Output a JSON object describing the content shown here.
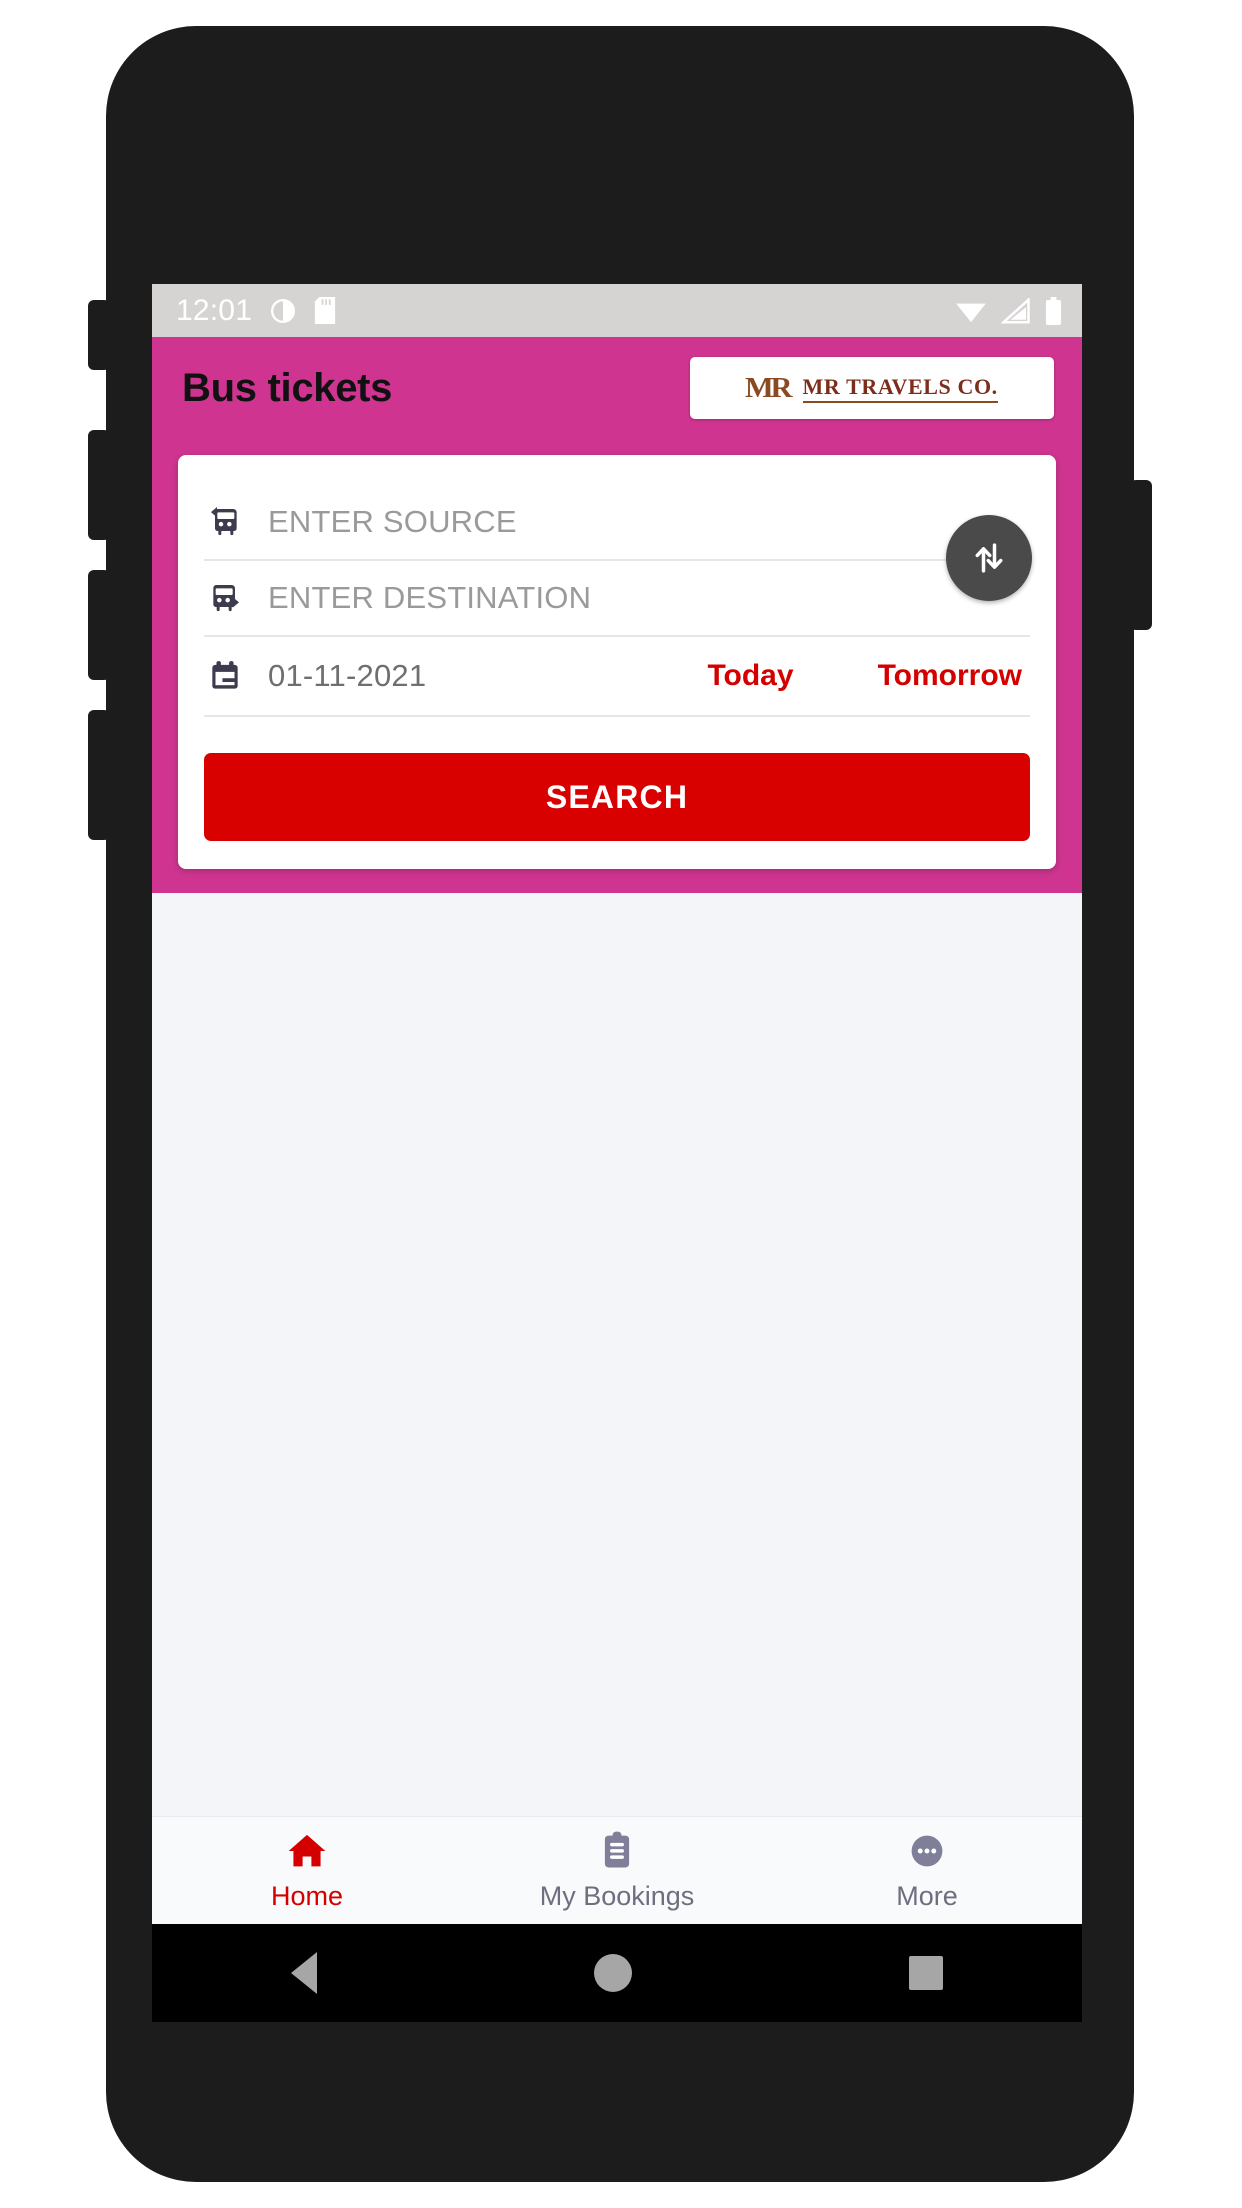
{
  "status_bar": {
    "clock": "12:01",
    "left_icons": [
      "do-not-disturb-icon",
      "sd-card-icon"
    ],
    "right_icons": [
      "wifi-icon",
      "cellular-signal-icon",
      "battery-icon"
    ]
  },
  "header": {
    "title": "Bus tickets",
    "brand": {
      "monogram": "MR",
      "name": "MR TRAVELS CO."
    },
    "background_color": "#cf3590"
  },
  "search_form": {
    "source": {
      "placeholder": "ENTER SOURCE",
      "value": "",
      "icon": "bus-departure-icon"
    },
    "destination": {
      "placeholder": "ENTER DESTINATION",
      "value": "",
      "icon": "bus-arrival-icon"
    },
    "date": {
      "value": "01-11-2021",
      "icon": "calendar-icon"
    },
    "quick_dates": [
      {
        "label": "Today"
      },
      {
        "label": "Tomorrow"
      }
    ],
    "swap_icon": "swap-vertical-icon",
    "search_label": "SEARCH",
    "accent_color": "#d90000"
  },
  "bottom_nav": {
    "items": [
      {
        "label": "Home",
        "icon": "home-icon",
        "active": true
      },
      {
        "label": "My Bookings",
        "icon": "clipboard-icon",
        "active": false
      },
      {
        "label": "More",
        "icon": "ellipsis-circle-icon",
        "active": false
      }
    ],
    "active_color": "#d40000",
    "inactive_color": "#6e6e80"
  },
  "android_nav": {
    "back": "back-triangle-icon",
    "home": "home-circle-icon",
    "recents": "recents-square-icon"
  }
}
